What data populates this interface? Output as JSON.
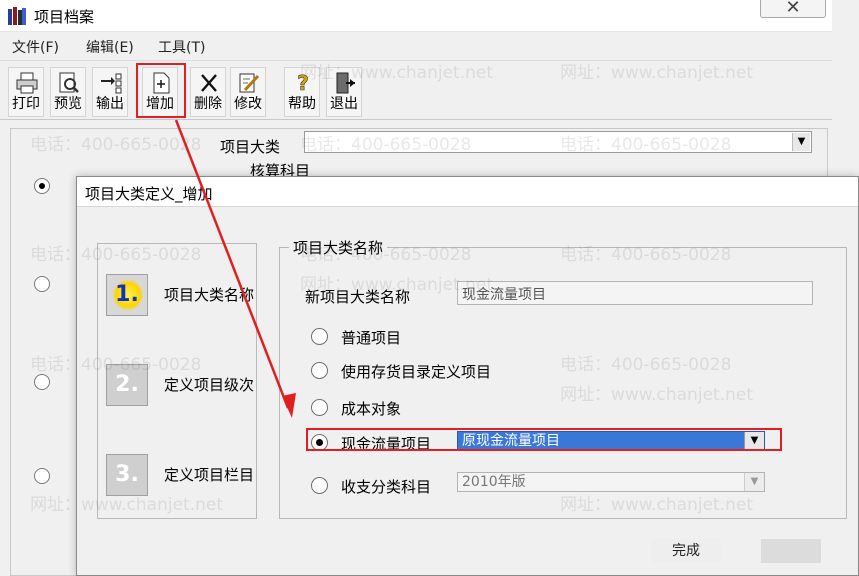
{
  "window": {
    "title": "项目档案"
  },
  "menu": {
    "items": [
      "文件(F)",
      "编辑(E)",
      "工具(T)"
    ]
  },
  "toolbar": {
    "buttons": [
      "打印",
      "预览",
      "输出",
      "增加",
      "删除",
      "修改",
      "帮助",
      "退出"
    ]
  },
  "main": {
    "category_label": "项目大类",
    "category_value": "",
    "hidden_label": "核算科目"
  },
  "dialog": {
    "title": "项目大类定义_增加",
    "steps": [
      {
        "number": "1.",
        "label": "项目大类名称"
      },
      {
        "number": "2.",
        "label": "定义项目级次"
      },
      {
        "number": "3.",
        "label": "定义项目栏目"
      }
    ],
    "group_title": "项目大类名称",
    "name_label": "新项目大类名称",
    "name_value": "现金流量项目",
    "options": [
      "普通项目",
      "使用存货目录定义项目",
      "成本对象",
      "现金流量项目",
      "收支分类科目"
    ],
    "selected_option": "现金流量项目",
    "cash_select_value": "原现金流量项目",
    "year_select_value": "2010年版",
    "finish_label": "完成"
  },
  "watermark": {
    "phone": "电话：400-665-0028",
    "site": "网址：www.chanjet.net"
  },
  "colors": {
    "highlight_red": "#e02020",
    "selection_blue": "#3a78d8"
  }
}
